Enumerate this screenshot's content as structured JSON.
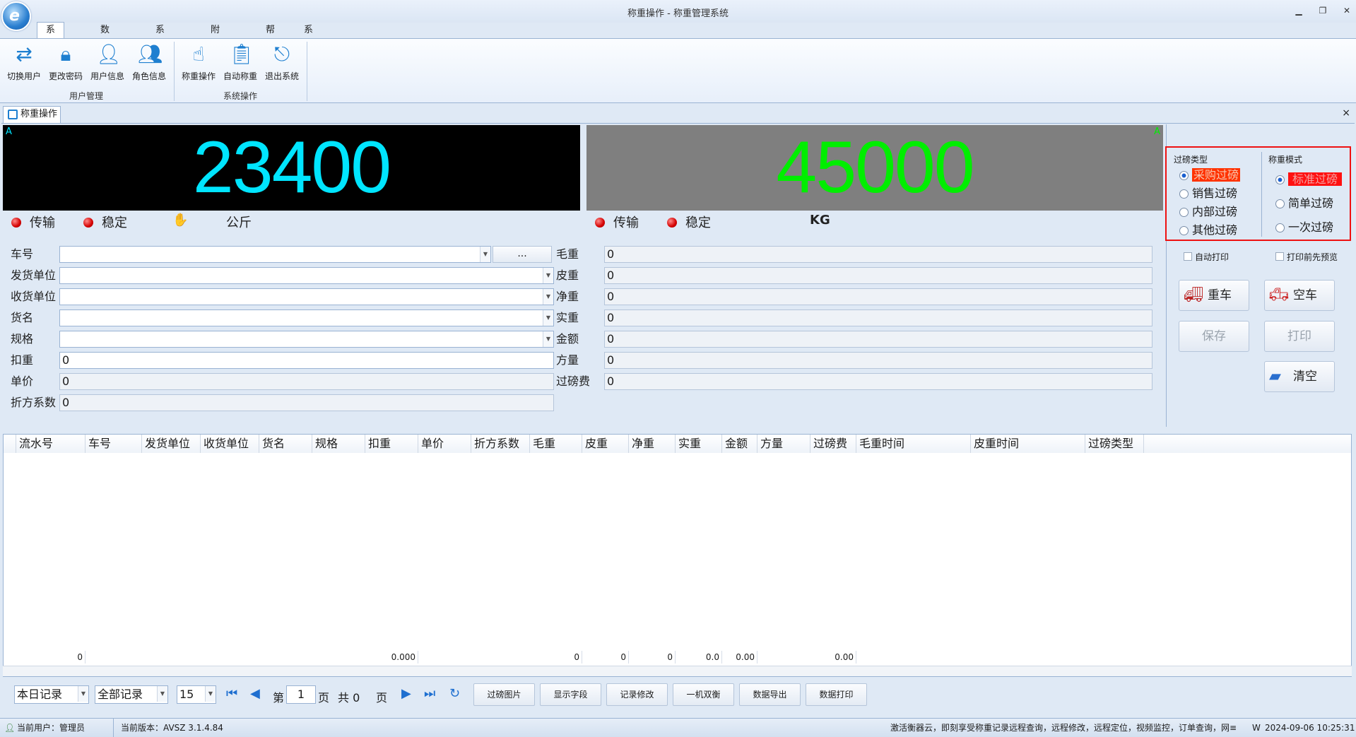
{
  "window": {
    "title": "称重操作 - 称重管理系统",
    "minimize": "▁",
    "restore": "❐",
    "close": "✕"
  },
  "ribbon_tabs": [
    "系统管理",
    "数据管理",
    "系统维护",
    "附加工具",
    "帮助",
    "系统皮肤"
  ],
  "ribbon": {
    "group1": {
      "label": "用户管理",
      "buttons": [
        "切换用户",
        "更改密码",
        "用户信息",
        "角色信息"
      ]
    },
    "group2": {
      "label": "系统操作",
      "buttons": [
        "称重操作",
        "自动称重",
        "退出系统"
      ]
    }
  },
  "doc_tab": {
    "label": "称重操作",
    "close": "×"
  },
  "display_left": {
    "value": "23400",
    "channel": "A",
    "status1": "传输",
    "status2": "稳定",
    "unit": "公斤",
    "hand_icon": "✋"
  },
  "display_right": {
    "value": "45000",
    "channel": "A",
    "status1": "传输",
    "status2": "稳定",
    "unit": "KG"
  },
  "form_left": {
    "labels": [
      "车号",
      "发货单位",
      "收货单位",
      "货名",
      "规格",
      "扣重",
      "单价",
      "折方系数"
    ],
    "values": [
      "",
      "",
      "",
      "",
      "",
      "0",
      "0",
      "0"
    ],
    "ellipsis": "..."
  },
  "form_right": {
    "labels": [
      "毛重",
      "皮重",
      "净重",
      "实重",
      "金额",
      "方量",
      "过磅费"
    ],
    "values": [
      "0",
      "0",
      "0",
      "0",
      "0",
      "0",
      "0"
    ]
  },
  "weigh_type": {
    "title": "过磅类型",
    "options": [
      "采购过磅",
      "销售过磅",
      "内部过磅",
      "其他过磅"
    ],
    "selected": "采购过磅"
  },
  "weigh_mode": {
    "title": "称重模式",
    "options": [
      "标准过磅",
      "简单过磅",
      "一次过磅"
    ],
    "selected": "标准过磅"
  },
  "checks": {
    "auto_print": "自动打印",
    "preview": "打印前先预览"
  },
  "action_buttons": {
    "heavy": "重车",
    "empty": "空车",
    "save": "保存",
    "print": "打印",
    "clear": "清空"
  },
  "grid": {
    "columns": [
      "流水号",
      "车号",
      "发货单位",
      "收货单位",
      "货名",
      "规格",
      "扣重",
      "单价",
      "折方系数",
      "毛重",
      "皮重",
      "净重",
      "实重",
      "金额",
      "方量",
      "过磅费",
      "毛重时间",
      "皮重时间",
      "过磅类型"
    ],
    "summary": [
      "0",
      "0.000",
      "0",
      "0",
      "0",
      "0.0",
      "0.00",
      "0.00"
    ]
  },
  "pager": {
    "range": "本日记录",
    "filter": "全部记录",
    "page_size": "15",
    "page_prefix": "第",
    "page": "1",
    "page_suffix": "页",
    "total": "共 0",
    "total_suffix": "页",
    "buttons": [
      "过磅图片",
      "显示字段",
      "记录修改",
      "一机双衡",
      "数据导出",
      "数据打印"
    ]
  },
  "status": {
    "user": "当前用户：管理员",
    "version": "当前版本：AVSZ 3.1.4.84",
    "promo": "激活衡器云，即刻享受称重记录远程查询，远程修改，远程定位，视频监控，订单查询，网≡",
    "w": "W",
    "datetime": "2024-09-06 10:25:31"
  },
  "colors": {
    "left_digits": "#00e5ff",
    "right_digits": "#00ee00",
    "left_bg": "#000000",
    "right_bg": "#7f7f7f",
    "highlight": "#ff3300"
  }
}
